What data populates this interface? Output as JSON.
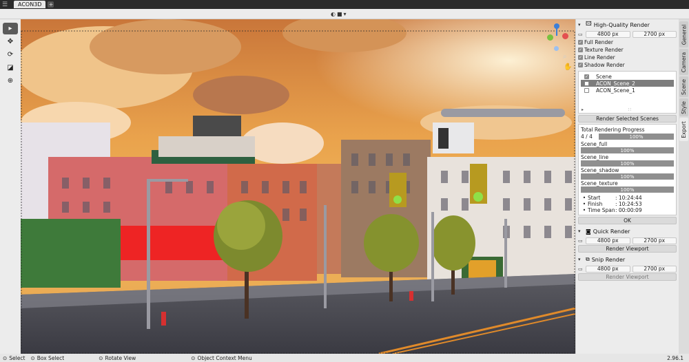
{
  "topbar": {
    "tab_label": "ACON3D",
    "add_label": "+"
  },
  "header": {
    "shading_icon": "viewport-shading-icon"
  },
  "toolbar": {
    "tools": [
      "select-cursor-icon",
      "move-icon",
      "rotate-icon",
      "scale-icon",
      "transform-icon"
    ]
  },
  "navigation": {
    "gizmo": "orientation-gizmo",
    "icons": [
      "zoom-icon",
      "pan-hand-icon"
    ]
  },
  "hq_render": {
    "title": "High-Quality Render",
    "width": "4800 px",
    "height": "2700 px",
    "options": [
      {
        "label": "Full Render",
        "checked": true
      },
      {
        "label": "Texture Render",
        "checked": true
      },
      {
        "label": "Line Render",
        "checked": true
      },
      {
        "label": "Shadow Render",
        "checked": true
      }
    ],
    "scenes": [
      {
        "label": "Scene",
        "checked": true,
        "selected": false
      },
      {
        "label": "ACON_Scene_2",
        "checked": false,
        "selected": true
      },
      {
        "label": "ACON_Scene_1",
        "checked": false,
        "selected": false
      }
    ],
    "render_button": "Render Selected Scenes",
    "progress": {
      "title": "Total Rendering Progress",
      "count": "4 / 4",
      "total_pct": "100%",
      "items": [
        {
          "label": "Scene_full",
          "pct": "100%"
        },
        {
          "label": "Scene_line",
          "pct": "100%"
        },
        {
          "label": "Scene_shadow",
          "pct": "100%"
        },
        {
          "label": "Scene_texture",
          "pct": "100%"
        }
      ],
      "start_label": "Start",
      "start_value": ": 10:24:44",
      "finish_label": "Finish",
      "finish_value": ": 10:24:53",
      "span_label": "Time Span",
      "span_value": ": 00:00:09"
    },
    "ok_button": "OK"
  },
  "quick_render": {
    "title": "Quick Render",
    "width": "4800 px",
    "height": "2700 px",
    "button": "Render Viewport"
  },
  "snip_render": {
    "title": "Snip Render",
    "width": "4800 px",
    "height": "2700 px",
    "button": "Render Viewport"
  },
  "side_tabs": [
    "General",
    "Camera",
    "Scene",
    "Style",
    "Export"
  ],
  "status": {
    "select": "Select",
    "box_select": "Box Select",
    "rotate_view": "Rotate View",
    "context_menu": "Object Context Menu",
    "version": "2.96.1"
  }
}
